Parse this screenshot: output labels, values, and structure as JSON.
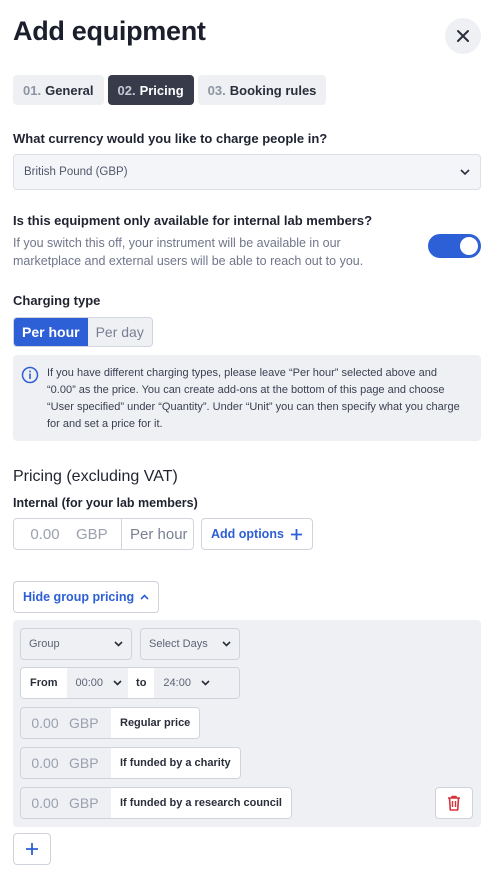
{
  "header": {
    "title": "Add equipment"
  },
  "tabs": [
    {
      "num": "01.",
      "label": "General"
    },
    {
      "num": "02.",
      "label": "Pricing"
    },
    {
      "num": "03.",
      "label": "Booking rules"
    }
  ],
  "currency": {
    "question": "What currency would you like to charge people in?",
    "selected": "British Pound (GBP)"
  },
  "internal_only": {
    "question": "Is this equipment only available for internal lab members?",
    "help": "If you switch this off, your instrument will be available in our marketplace and external users will be able to reach out to you.",
    "enabled": true
  },
  "charging_type": {
    "label": "Charging type",
    "options": [
      "Per hour",
      "Per day"
    ],
    "selected": "Per hour"
  },
  "info_box": {
    "text": "If you have different charging types, please leave “Per hour” selected above and “0.00” as the price. You can create add-ons at the bottom of this page and choose “User specified” under “Quantity”. Under “Unit” you can then specify what you charge for and set a price for it."
  },
  "pricing": {
    "heading": "Pricing (excluding VAT)",
    "internal_label": "Internal (for your lab members)",
    "amount_placeholder": "0.00",
    "currency": "GBP",
    "unit": "Per hour",
    "add_options_label": "Add options"
  },
  "group_pricing": {
    "toggle_label": "Hide group pricing",
    "group_placeholder": "Group",
    "days_placeholder": "Select Days",
    "from_label": "From",
    "from_value": "00:00",
    "to_label": "to",
    "to_value": "24:00",
    "rows": [
      {
        "amount": "0.00",
        "currency": "GBP",
        "name": "Regular price"
      },
      {
        "amount": "0.00",
        "currency": "GBP",
        "name": "If funded by a charity"
      },
      {
        "amount": "0.00",
        "currency": "GBP",
        "name": "If funded by a research council"
      }
    ]
  },
  "colors": {
    "accent": "#2d5fd6",
    "danger": "#d6323a",
    "panel": "#eef0f4"
  }
}
